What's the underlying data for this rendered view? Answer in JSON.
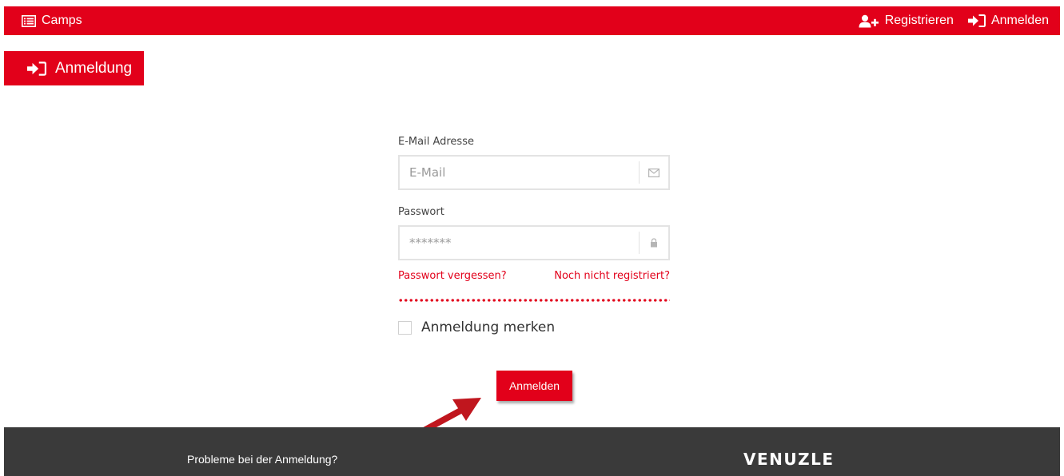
{
  "nav": {
    "camps_label": "Camps",
    "register_label": "Registrieren",
    "login_label": "Anmelden",
    "icons": {
      "camps": "list-icon",
      "register": "user-plus-icon",
      "login": "sign-in-icon"
    }
  },
  "page": {
    "title": "Anmeldung",
    "title_icon": "sign-in-icon"
  },
  "form": {
    "email_label": "E-Mail Adresse",
    "email_placeholder": "E-Mail",
    "email_icon": "envelope-icon",
    "password_label": "Passwort",
    "password_placeholder": "*******",
    "password_icon": "lock-icon",
    "forgot_link": "Passwort vergessen?",
    "register_link": "Noch nicht registriert?",
    "remember_label": "Anmeldung merken",
    "remember_checked": false,
    "submit_label": "Anmelden"
  },
  "footer": {
    "help_link": "Probleme bei der Anmeldung?",
    "brand": "VENUZLE"
  },
  "colors": {
    "brand_red": "#e2001a",
    "footer_bg": "#3a3a3a",
    "annotation_arrow": "#c0161e"
  }
}
